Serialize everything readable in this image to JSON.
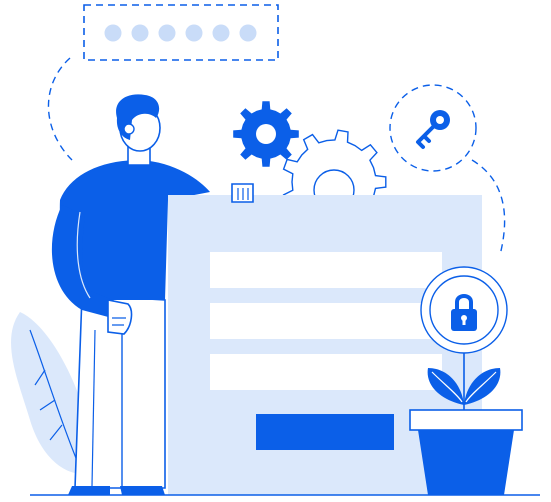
{
  "illustration": {
    "theme": "login-security",
    "password_mask_dots": 6,
    "icons": [
      "gear-icon",
      "key-icon",
      "lock-icon",
      "leaf-icon"
    ],
    "colors": {
      "primary": "#0b5fe8",
      "light": "#dbe8fb",
      "pale": "#e8f0fc",
      "outline": "#0b5fe8",
      "dot": "#c9dcf8",
      "white": "#ffffff"
    }
  }
}
